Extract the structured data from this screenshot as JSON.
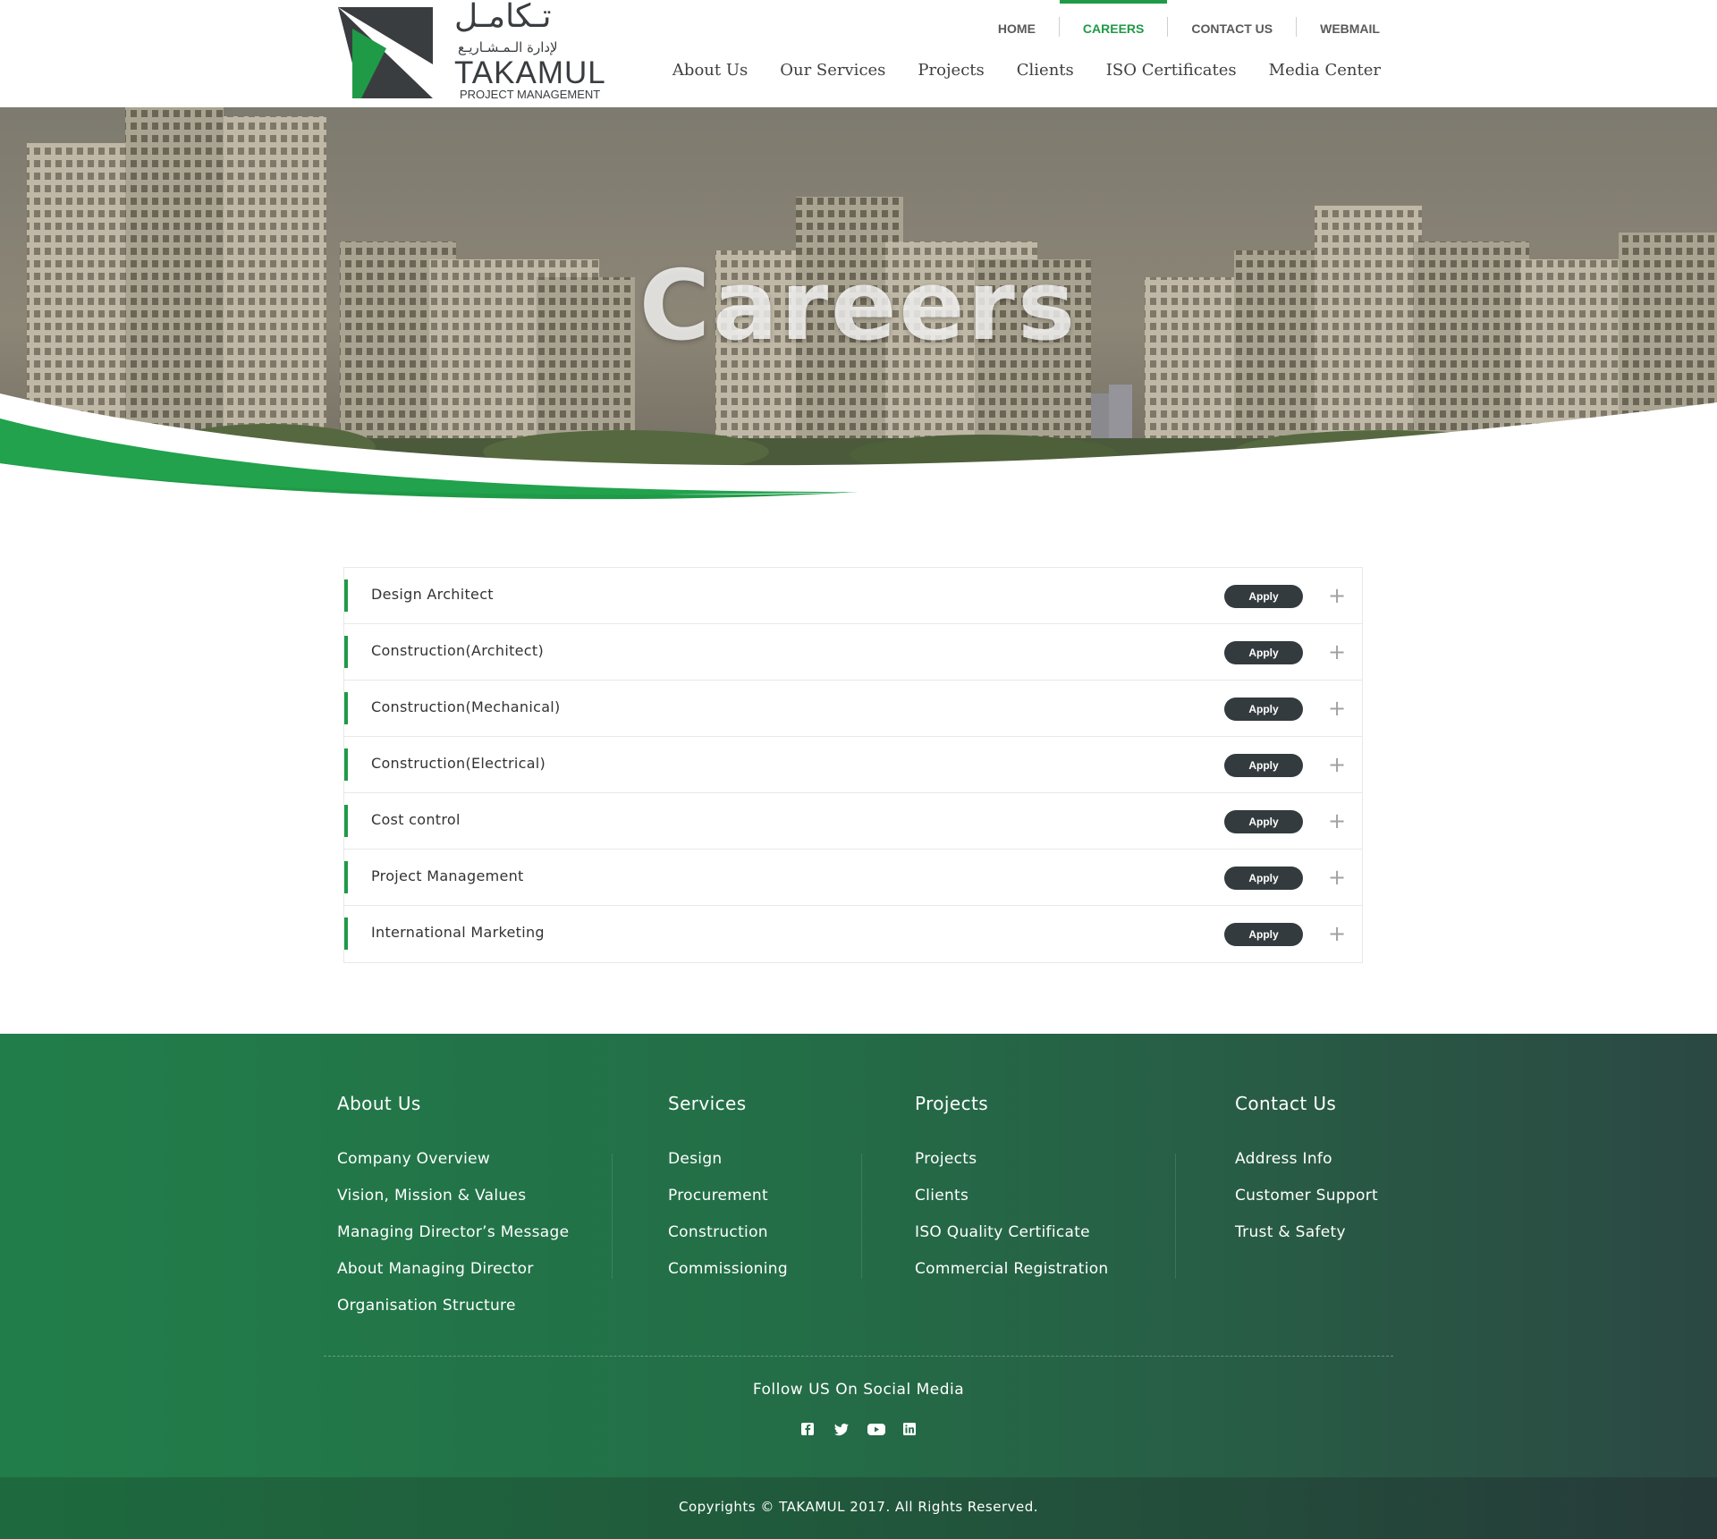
{
  "brand": {
    "arabic_name": "تـكامـل",
    "arabic_sub": "لإدارة الـمـشـاريـع",
    "name": "TAKAMUL",
    "tagline": "PROJECT MANAGEMENT",
    "accent_color": "#1f9a47",
    "dark_color": "#333b3e"
  },
  "top_nav": {
    "items": [
      {
        "label": "HOME",
        "active": false
      },
      {
        "label": "CAREERS",
        "active": true
      },
      {
        "label": "CONTACT US",
        "active": false
      },
      {
        "label": "WEBMAIL",
        "active": false
      }
    ]
  },
  "main_nav": {
    "items": [
      {
        "label": "About Us"
      },
      {
        "label": "Our Services"
      },
      {
        "label": "Projects"
      },
      {
        "label": "Clients"
      },
      {
        "label": "ISO Certificates"
      },
      {
        "label": "Media Center"
      }
    ]
  },
  "hero": {
    "title": "Careers"
  },
  "jobs": {
    "items": [
      {
        "title": "Design Architect",
        "apply_label": "Apply",
        "expand_icon": "plus-icon"
      },
      {
        "title": "Construction(Architect)",
        "apply_label": "Apply",
        "expand_icon": "plus-icon"
      },
      {
        "title": "Construction(Mechanical)",
        "apply_label": "Apply",
        "expand_icon": "plus-icon"
      },
      {
        "title": "Construction(Electrical)",
        "apply_label": "Apply",
        "expand_icon": "plus-icon"
      },
      {
        "title": "Cost control",
        "apply_label": "Apply",
        "expand_icon": "plus-icon"
      },
      {
        "title": "Project Management",
        "apply_label": "Apply",
        "expand_icon": "plus-icon"
      },
      {
        "title": "International Marketing",
        "apply_label": "Apply",
        "expand_icon": "plus-icon"
      }
    ]
  },
  "footer": {
    "columns": [
      {
        "heading": "About Us",
        "links": [
          "Company Overview",
          "Vision, Mission & Values",
          "Managing Director’s Message",
          "About Managing Director",
          "Organisation Structure"
        ]
      },
      {
        "heading": "Services",
        "links": [
          "Design",
          "Procurement",
          "Construction",
          "Commissioning"
        ]
      },
      {
        "heading": "Projects",
        "links": [
          "Projects",
          "Clients",
          "ISO Quality Certificate",
          "Commercial Registration"
        ]
      },
      {
        "heading": "Contact Us",
        "links": [
          "Address Info",
          "Customer Support",
          "Trust & Safety"
        ]
      }
    ],
    "follow_text": "Follow US On Social Media",
    "socials": [
      "facebook-icon",
      "twitter-icon",
      "youtube-icon",
      "linkedin-icon"
    ],
    "copyright": "Copyrights © TAKAMUL 2017. All Rights Reserved."
  }
}
